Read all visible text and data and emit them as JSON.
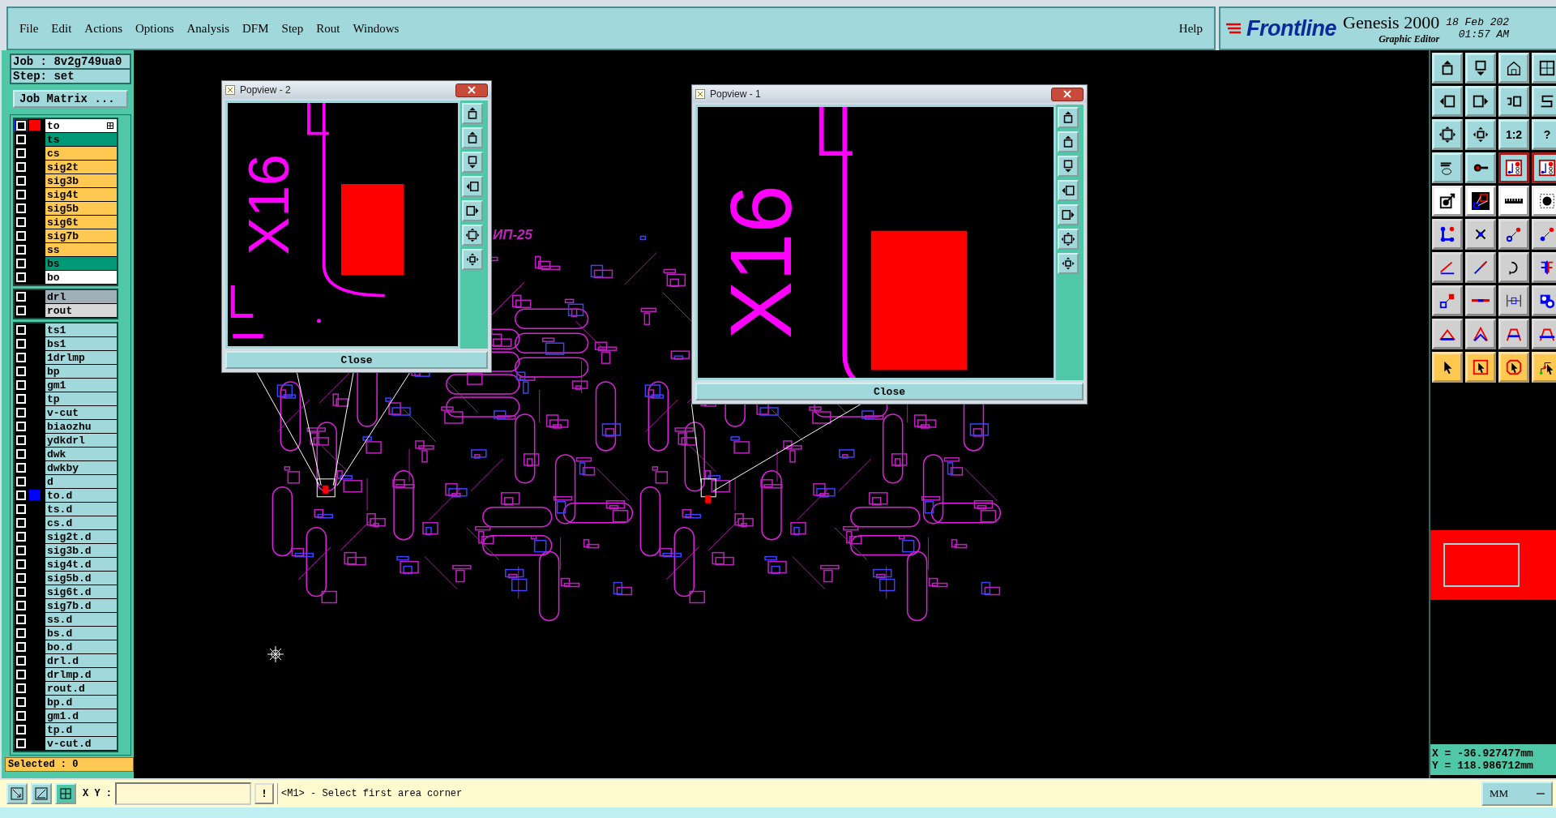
{
  "menu": [
    "File",
    "Edit",
    "Actions",
    "Options",
    "Analysis",
    "DFM",
    "Step",
    "Rout",
    "Windows"
  ],
  "help": "Help",
  "brand": {
    "logo": "Frontline",
    "product": "Genesis 2000",
    "subtitle": "Graphic Editor",
    "date": "18 Feb 202",
    "time": "01:57 AM"
  },
  "job": {
    "job": "Job : 8v2g749ua0",
    "step": "Step: set",
    "matrix_button": "Job Matrix ..."
  },
  "layer_groups": [
    {
      "layers": [
        {
          "name": "to",
          "color": "#ffffff",
          "checked": false,
          "active": true,
          "marker": {
            "color": "#ff0000"
          }
        },
        {
          "name": "ts",
          "color": "#009977",
          "checked": false,
          "active": false
        },
        {
          "name": "cs",
          "color": "#ffc850",
          "checked": false,
          "active": false
        },
        {
          "name": "sig2t",
          "color": "#ffc850",
          "checked": false,
          "active": false
        },
        {
          "name": "sig3b",
          "color": "#ffc850",
          "checked": false,
          "active": false
        },
        {
          "name": "sig4t",
          "color": "#ffc850",
          "checked": false,
          "active": false
        },
        {
          "name": "sig5b",
          "color": "#ffc850",
          "checked": false,
          "active": false
        },
        {
          "name": "sig6t",
          "color": "#ffc850",
          "checked": false,
          "active": false
        },
        {
          "name": "sig7b",
          "color": "#ffc850",
          "checked": false,
          "active": false
        },
        {
          "name": "ss",
          "color": "#ffc850",
          "checked": false,
          "active": false
        },
        {
          "name": "bs",
          "color": "#009977",
          "checked": false,
          "active": false
        },
        {
          "name": "bo",
          "color": "#ffffff",
          "checked": false,
          "active": false
        }
      ]
    },
    {
      "layers": [
        {
          "name": "drl",
          "color": "#a0b0b8",
          "checked": false,
          "active": false
        },
        {
          "name": "rout",
          "color": "#d8d8d8",
          "checked": false,
          "active": false
        }
      ]
    },
    {
      "layers": [
        {
          "name": "ts1",
          "color": "#a0d8dc",
          "checked": false,
          "active": false
        },
        {
          "name": "bs1",
          "color": "#a0d8dc",
          "checked": false,
          "active": false
        },
        {
          "name": "1drlmp",
          "color": "#a0d8dc",
          "checked": false,
          "active": false
        },
        {
          "name": "bp",
          "color": "#a0d8dc",
          "checked": false,
          "active": false
        },
        {
          "name": "gm1",
          "color": "#a0d8dc",
          "checked": false,
          "active": false
        },
        {
          "name": "tp",
          "color": "#a0d8dc",
          "checked": false,
          "active": false
        },
        {
          "name": "v-cut",
          "color": "#a0d8dc",
          "checked": false,
          "active": false
        },
        {
          "name": "biaozhu",
          "color": "#a0d8dc",
          "checked": false,
          "active": false
        },
        {
          "name": "ydkdrl",
          "color": "#a0d8dc",
          "checked": false,
          "active": false
        },
        {
          "name": "dwk",
          "color": "#a0d8dc",
          "checked": false,
          "active": false
        },
        {
          "name": "dwkby",
          "color": "#a0d8dc",
          "checked": false,
          "active": false
        },
        {
          "name": "d",
          "color": "#a0d8dc",
          "checked": false,
          "active": false
        },
        {
          "name": "to.d",
          "color": "#a0d8dc",
          "checked": false,
          "active": false,
          "marker": {
            "color": "#0000ff"
          }
        },
        {
          "name": "ts.d",
          "color": "#a0d8dc",
          "checked": false,
          "active": false
        },
        {
          "name": "cs.d",
          "color": "#a0d8dc",
          "checked": false,
          "active": false
        },
        {
          "name": "sig2t.d",
          "color": "#a0d8dc",
          "checked": false,
          "active": false
        },
        {
          "name": "sig3b.d",
          "color": "#a0d8dc",
          "checked": false,
          "active": false
        },
        {
          "name": "sig4t.d",
          "color": "#a0d8dc",
          "checked": false,
          "active": false
        },
        {
          "name": "sig5b.d",
          "color": "#a0d8dc",
          "checked": false,
          "active": false
        },
        {
          "name": "sig6t.d",
          "color": "#a0d8dc",
          "checked": false,
          "active": false
        },
        {
          "name": "sig7b.d",
          "color": "#a0d8dc",
          "checked": false,
          "active": false
        },
        {
          "name": "ss.d",
          "color": "#a0d8dc",
          "checked": false,
          "active": false
        },
        {
          "name": "bs.d",
          "color": "#a0d8dc",
          "checked": false,
          "active": false
        },
        {
          "name": "bo.d",
          "color": "#a0d8dc",
          "checked": false,
          "active": false
        },
        {
          "name": "drl.d",
          "color": "#a0d8dc",
          "checked": false,
          "active": false
        },
        {
          "name": "drlmp.d",
          "color": "#a0d8dc",
          "checked": false,
          "active": false
        },
        {
          "name": "rout.d",
          "color": "#a0d8dc",
          "checked": false,
          "active": false
        },
        {
          "name": "bp.d",
          "color": "#a0d8dc",
          "checked": false,
          "active": false
        },
        {
          "name": "gm1.d",
          "color": "#a0d8dc",
          "checked": false,
          "active": false
        },
        {
          "name": "tp.d",
          "color": "#a0d8dc",
          "checked": false,
          "active": false
        },
        {
          "name": "v-cut.d",
          "color": "#a0d8dc",
          "checked": false,
          "active": false
        }
      ]
    }
  ],
  "selected_count": "Selected : 0",
  "canvas": {
    "label": "ИП-25"
  },
  "popviews": [
    {
      "title": "Popview - 2",
      "label": "X16",
      "close": "Close"
    },
    {
      "title": "Popview - 1",
      "label": "X16",
      "close": "Close"
    }
  ],
  "tool_texts": [
    "1:2",
    "?"
  ],
  "coordinates": [
    "X = -36.927477mm",
    "Y = 118.986712mm"
  ],
  "command_bar": {
    "xy_label": "X Y :",
    "alert": "!",
    "message": "<M1> - Select first area corner",
    "units": "MM"
  }
}
